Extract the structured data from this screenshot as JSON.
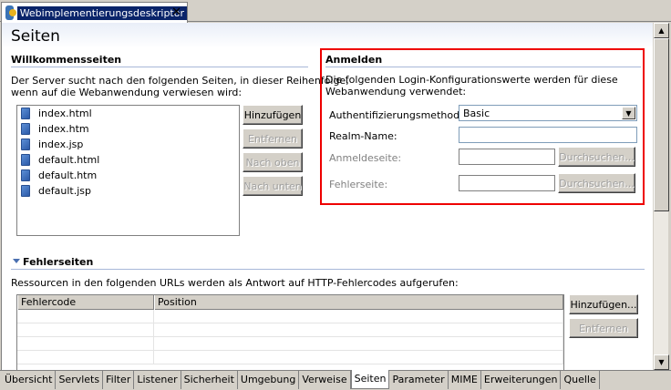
{
  "tab": {
    "title": "Webimplementierungsdeskriptor",
    "close": "✕"
  },
  "page": {
    "title": "Seiten"
  },
  "welcome": {
    "title": "Willkommensseiten",
    "description_line1": "Der Server sucht nach den folgenden Seiten, in dieser Reihenfolge,",
    "description_line2": "wenn auf die Webanwendung verwiesen wird:",
    "files": [
      "index.html",
      "index.htm",
      "index.jsp",
      "default.html",
      "default.htm",
      "default.jsp"
    ],
    "buttons": {
      "add": "Hinzufügen",
      "remove": "Entfernen",
      "up": "Nach oben",
      "down": "Nach unten"
    }
  },
  "login": {
    "title": "Anmelden",
    "description_line1": "Die folgenden Login-Konfigurationswerte werden für diese",
    "description_line2": "Webanwendung verwendet:",
    "auth_label": "Authentifizierungsmethode:",
    "auth_value": "Basic",
    "realm_label": "Realm-Name:",
    "realm_value": "",
    "login_page_label": "Anmeldeseite:",
    "login_page_value": "",
    "error_page_label": "Fehlerseite:",
    "error_page_value": "",
    "browse": "Durchsuchen..."
  },
  "errors": {
    "title": "Fehlerseiten",
    "description": "Ressourcen in den folgenden URLs werden als Antwort auf HTTP-Fehlercodes aufgerufen:",
    "columns": [
      "Fehlercode",
      "Position"
    ],
    "add": "Hinzufügen...",
    "remove": "Entfernen"
  },
  "bottom_tabs": [
    "Übersicht",
    "Servlets",
    "Filter",
    "Listener",
    "Sicherheit",
    "Umgebung",
    "Verweise",
    "Seiten",
    "Parameter",
    "MIME",
    "Erweiterungen",
    "Quelle"
  ],
  "active_bottom_tab": "Seiten",
  "colors": {
    "highlight_border": "#e00000",
    "section_line": "#a8b8d8",
    "title_bg": "#0a246a"
  }
}
